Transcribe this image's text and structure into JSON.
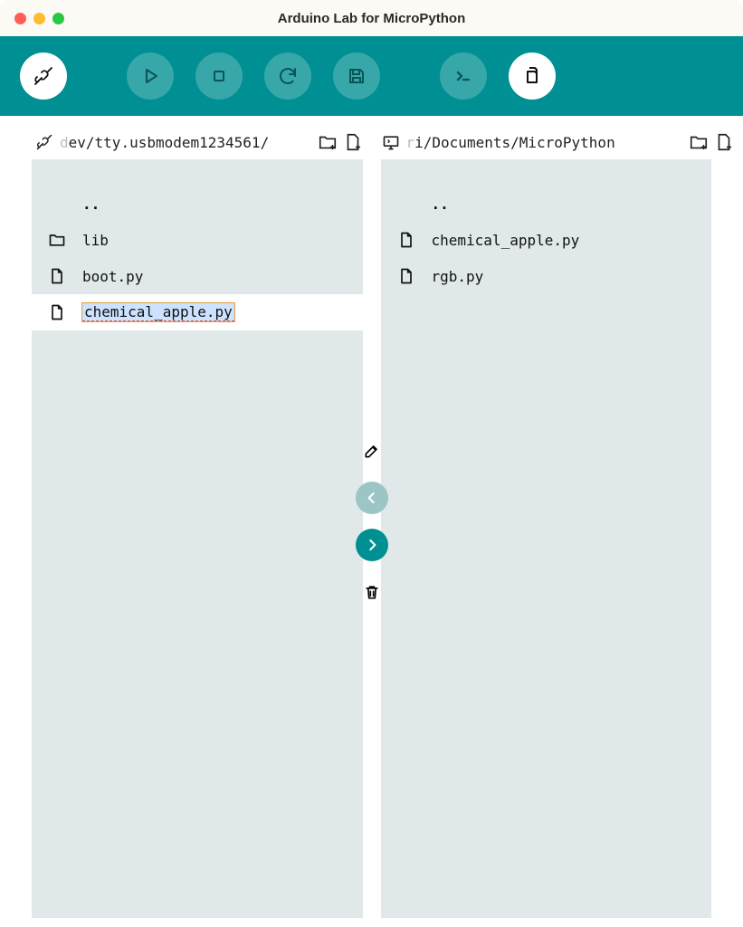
{
  "window": {
    "title": "Arduino Lab for MicroPython"
  },
  "toolbar": {
    "connect": "connect",
    "run": "run",
    "stop": "stop",
    "reload": "reload",
    "save": "save",
    "terminal": "terminal",
    "files": "files"
  },
  "panels": {
    "left": {
      "path_dim": "d",
      "path": "ev/tty.usbmodem1234561/",
      "items": [
        {
          "name": "..",
          "type": "up"
        },
        {
          "name": "lib",
          "type": "folder"
        },
        {
          "name": "boot.py",
          "type": "file"
        },
        {
          "name": "chemical_apple.py",
          "type": "file",
          "selected": true
        }
      ]
    },
    "right": {
      "path_dim": "r",
      "path": "i/Documents/MicroPython",
      "items": [
        {
          "name": "..",
          "type": "up"
        },
        {
          "name": "chemical_apple.py",
          "type": "file"
        },
        {
          "name": "rgb.py",
          "type": "file"
        }
      ]
    }
  },
  "mid": {
    "edit": "edit",
    "copy_left": "copy-to-device",
    "copy_right": "copy-to-computer",
    "delete": "delete"
  }
}
